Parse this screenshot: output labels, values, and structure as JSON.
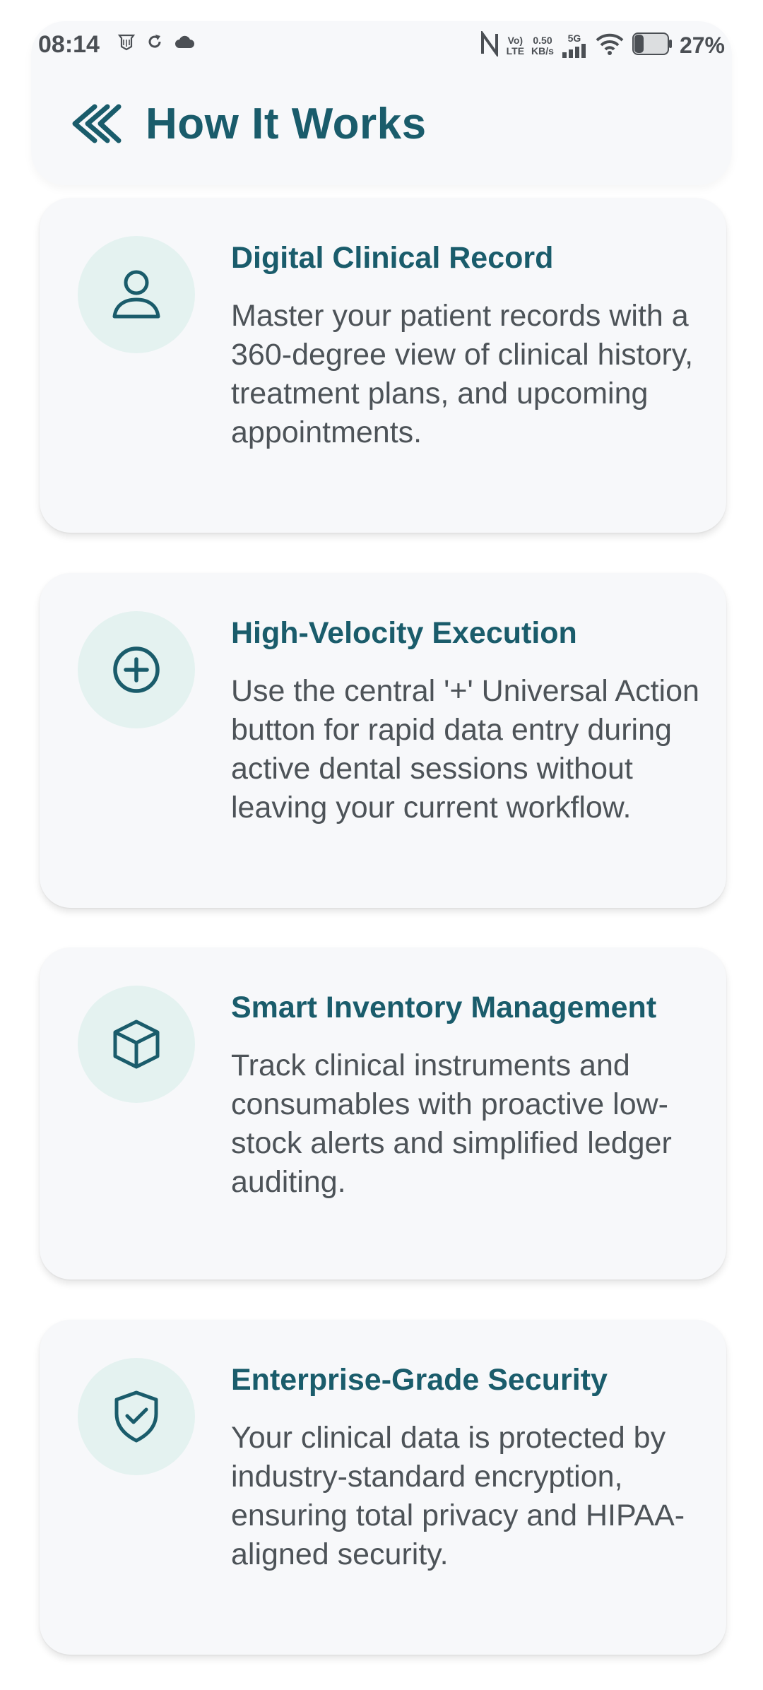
{
  "status_bar": {
    "time": "08:14",
    "left_icons": [
      "notification-icon",
      "sync-icon",
      "cloud-icon"
    ],
    "volte_top": "Vo)",
    "volte_bottom": "LTE",
    "speed_top": "0.50",
    "speed_bottom": "KB/s",
    "network_label": "5G",
    "battery_percent": "27%"
  },
  "header": {
    "title": "How It Works",
    "back_icon": "double-chevron-left-icon"
  },
  "colors": {
    "accent": "#1a5c6b",
    "icon_circle_bg": "#e4f2f0",
    "card_bg": "#f7f8fa",
    "body_text": "#4d5358"
  },
  "cards": [
    {
      "icon": "user-icon",
      "title": "Digital Clinical Record",
      "description": "Master your patient records with a 360-degree view of clinical history, treatment plans, and upcoming appointments."
    },
    {
      "icon": "plus-circle-icon",
      "title": "High-Velocity Execution",
      "description": "Use the central '+' Universal Action button for rapid data entry during active dental sessions without leaving your current workflow."
    },
    {
      "icon": "box-icon",
      "title": "Smart Inventory Management",
      "description": "Track clinical instruments and consumables with proactive low-stock alerts and simplified ledger auditing."
    },
    {
      "icon": "shield-check-icon",
      "title": "Enterprise-Grade Security",
      "description": "Your clinical data is protected by industry-standard encryption, ensuring total privacy and HIPAA-aligned security."
    }
  ]
}
